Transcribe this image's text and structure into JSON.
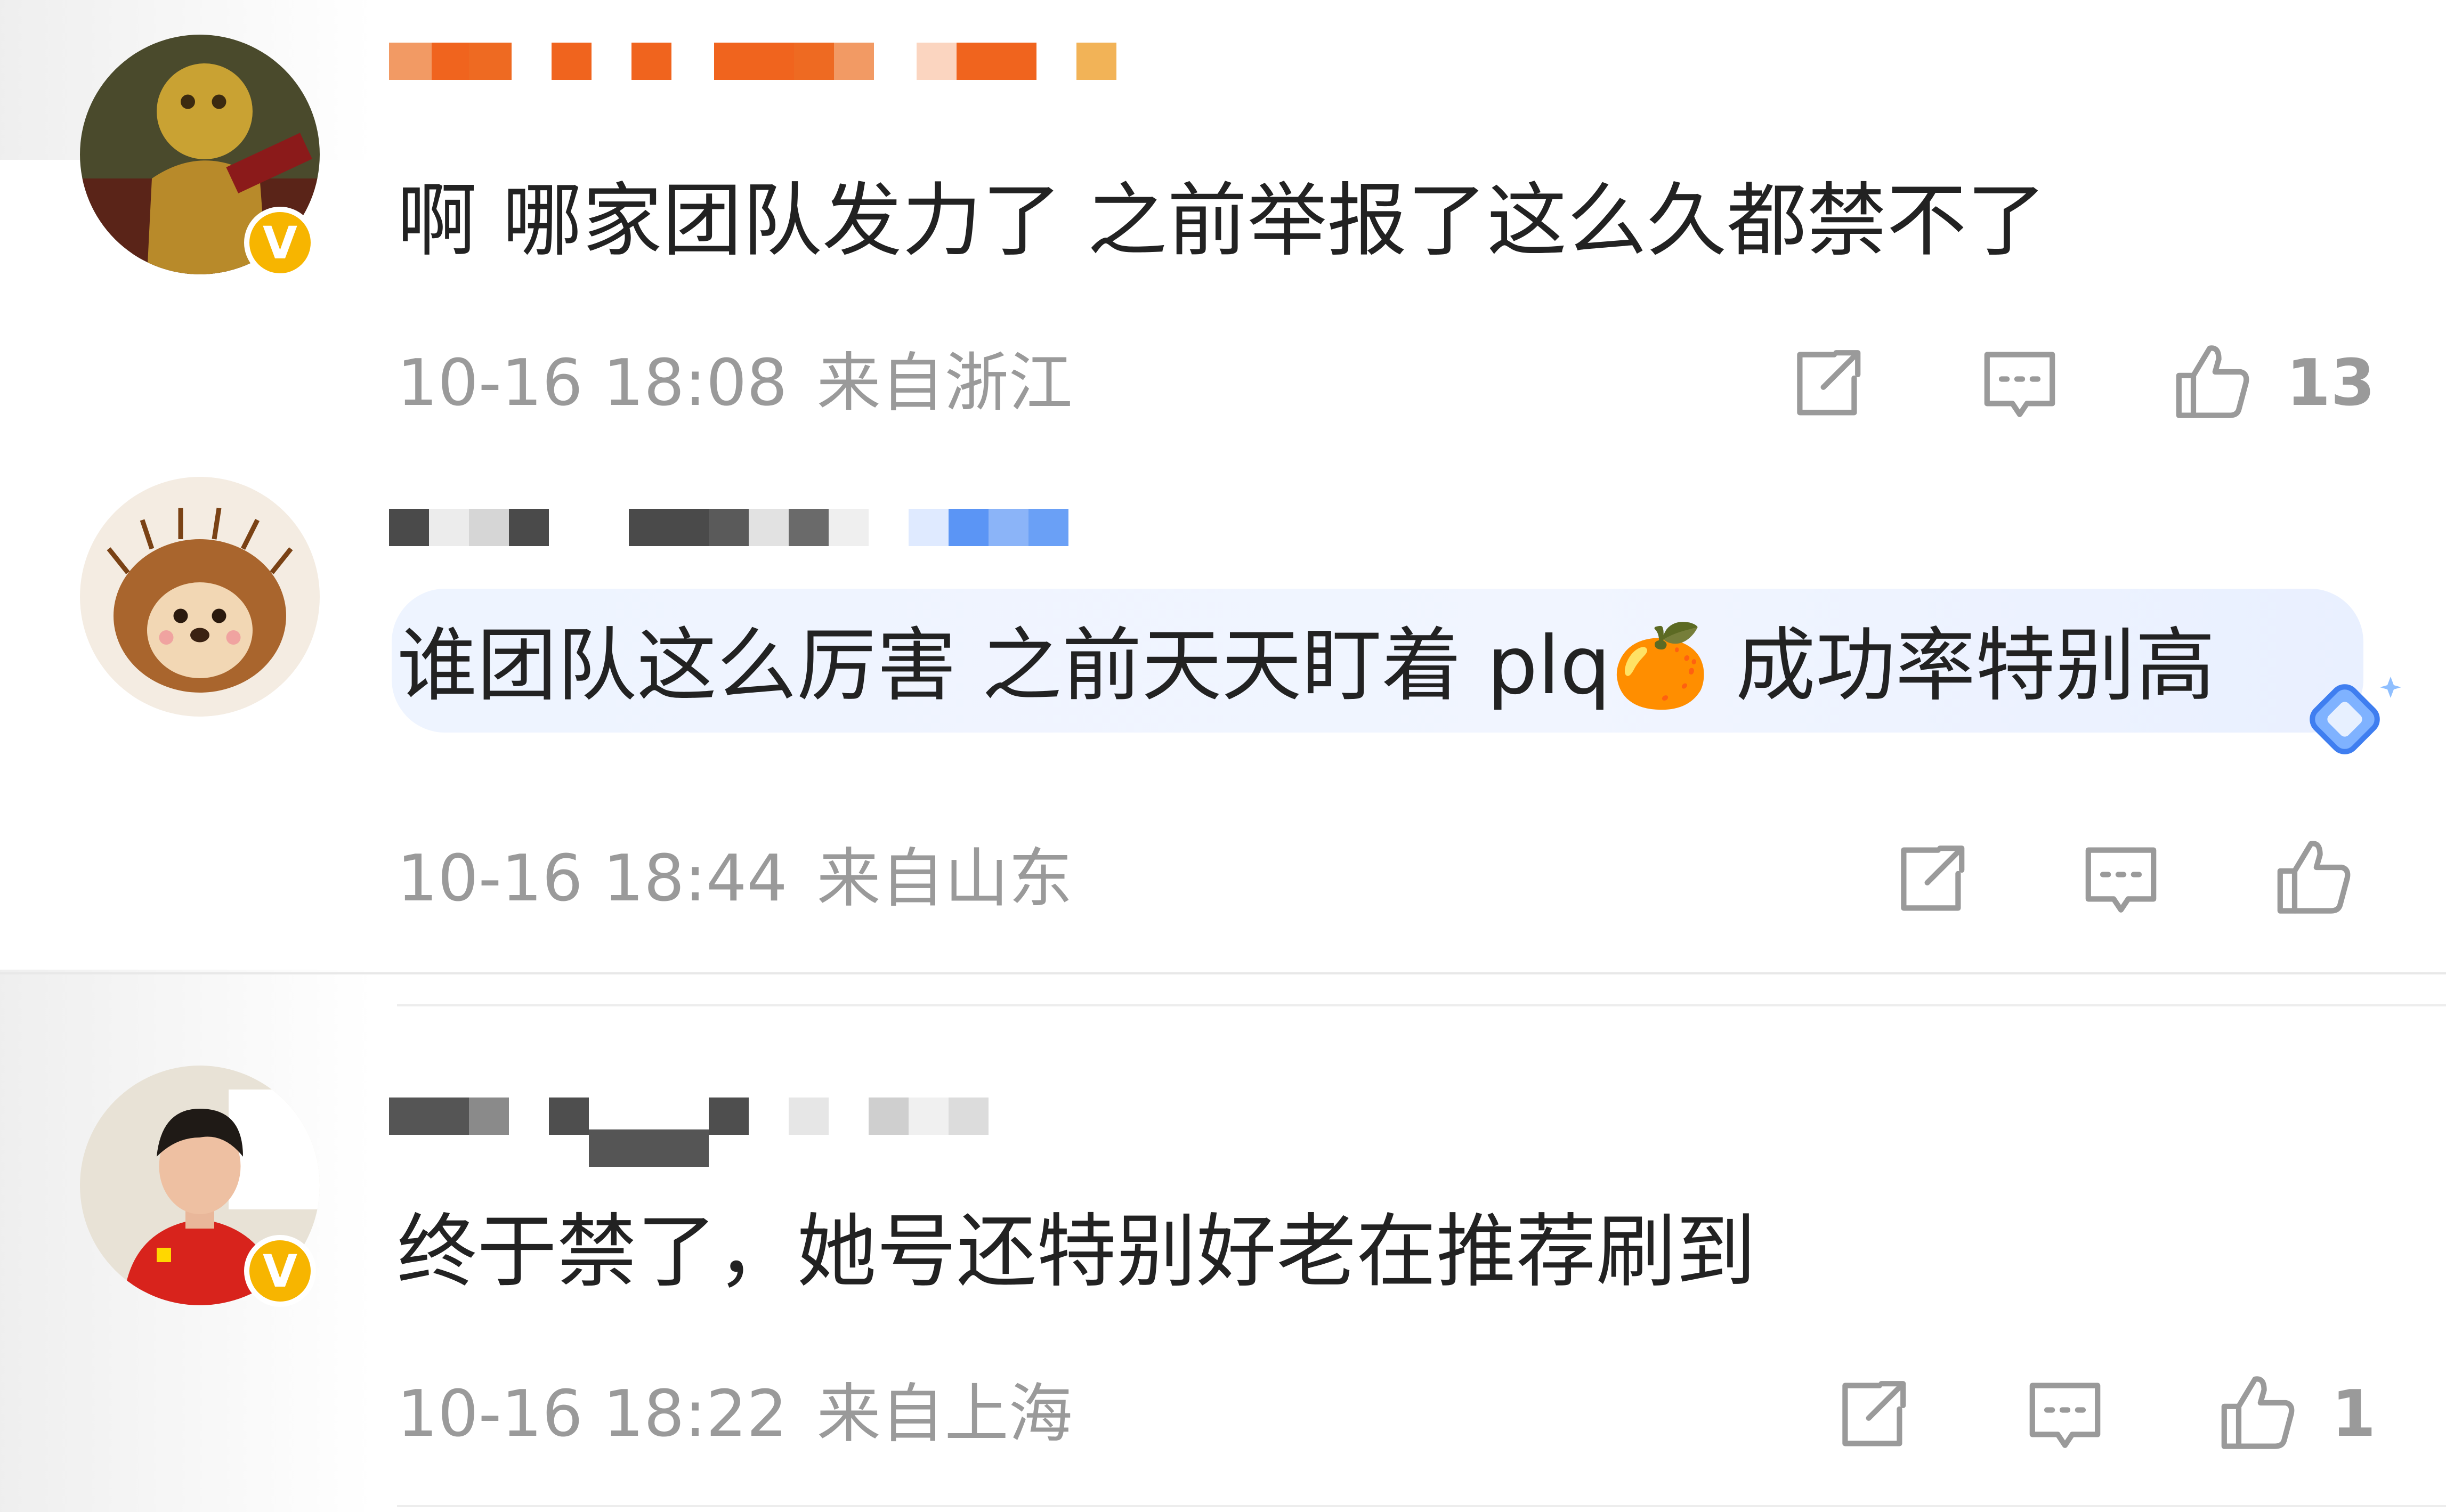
{
  "comments": [
    {
      "text": "啊  哪家团队发力了 之前举报了这么久都禁不了",
      "time": "10-16 18:08",
      "location": "来自浙江",
      "like_count": "13",
      "verified_badge": "V",
      "avatar": "leopard-warrior-avatar"
    },
    {
      "text_before_emoji": "谁团队这么厉害 之前天天盯着 plq",
      "emoji": "🍊",
      "text_after_emoji": " 成功率特别高",
      "time": "10-16 18:44",
      "location": "来自山东",
      "like_count": "",
      "avatar": "hedgehog-avatar"
    },
    {
      "text": "终于禁了，她号还特别好老在推荐刷到",
      "time": "10-16 18:22",
      "location": "来自上海",
      "like_count": "1",
      "verified_badge": "V",
      "avatar": "athlete-red-jersey-avatar"
    }
  ],
  "colors": {
    "username_c1": "#f0641e",
    "username_c3_accent": "#5b95f5",
    "meta_gray": "#9a9a9a",
    "badge_yellow": "#f7b500",
    "highlight_bg": "#eef4ff"
  },
  "icons": [
    "share-icon",
    "comment-icon",
    "like-icon",
    "badge-diamond-icon"
  ]
}
